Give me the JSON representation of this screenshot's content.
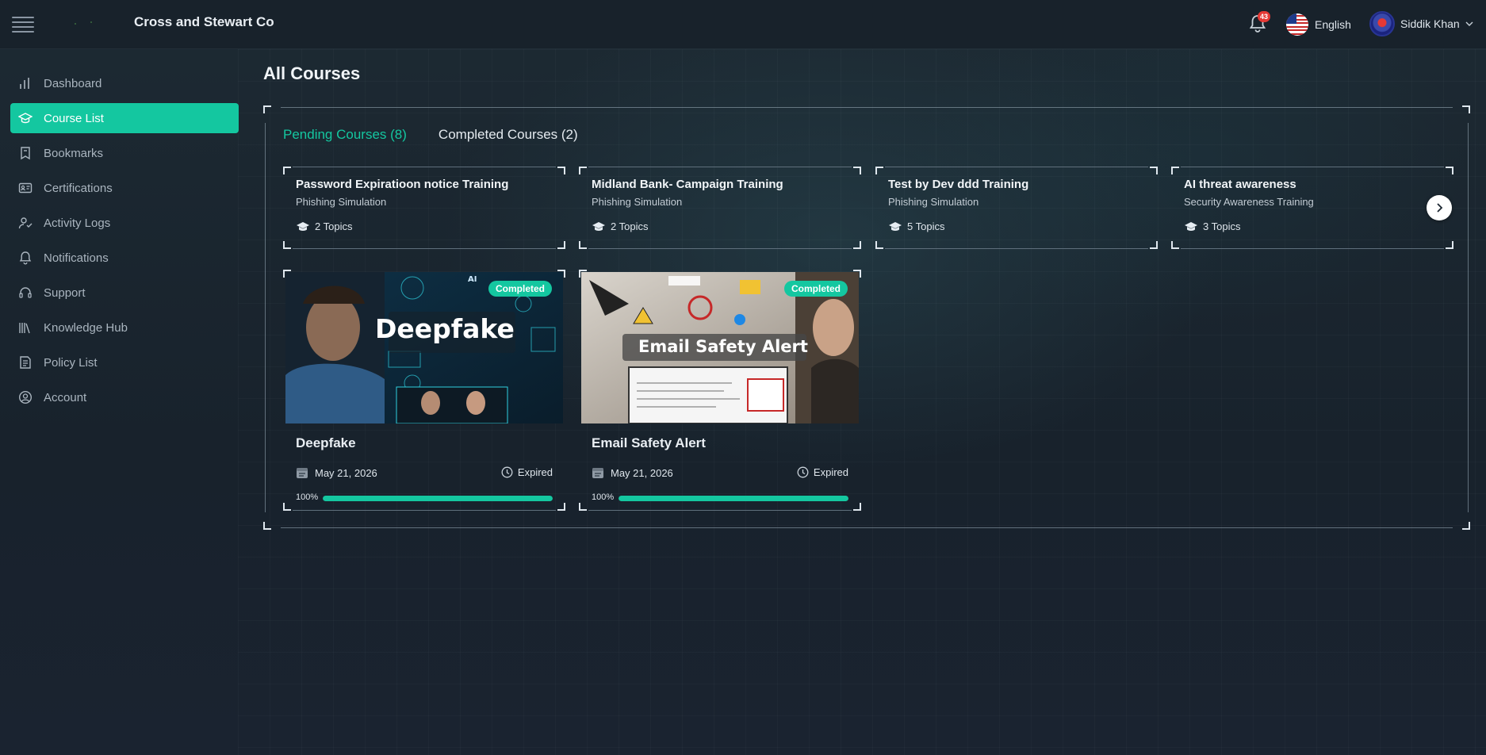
{
  "header": {
    "company": "Cross and Stewart Co",
    "notification_count": "43",
    "language": "English",
    "user_name": "Siddik Khan"
  },
  "sidebar": {
    "items": [
      {
        "label": "Dashboard",
        "icon": "bar-chart-icon"
      },
      {
        "label": "Course List",
        "icon": "graduation-cap-icon",
        "active": true
      },
      {
        "label": "Bookmarks",
        "icon": "bookmark-icon"
      },
      {
        "label": "Certifications",
        "icon": "id-card-icon"
      },
      {
        "label": "Activity Logs",
        "icon": "user-activity-icon"
      },
      {
        "label": "Notifications",
        "icon": "bell-icon"
      },
      {
        "label": "Support",
        "icon": "headset-icon"
      },
      {
        "label": "Knowledge Hub",
        "icon": "books-icon"
      },
      {
        "label": "Policy List",
        "icon": "document-list-icon"
      },
      {
        "label": "Account",
        "icon": "user-circle-icon"
      }
    ]
  },
  "main": {
    "title": "All Courses",
    "tabs": [
      {
        "label": "Pending Courses (8)",
        "active": true
      },
      {
        "label": "Completed Courses (2)",
        "active": false
      }
    ],
    "pending": [
      {
        "title": "Password Expiratioon notice Training",
        "type": "Phishing Simulation",
        "topics": "2 Topics"
      },
      {
        "title": "Midland Bank- Campaign Training",
        "type": "Phishing Simulation",
        "topics": "2 Topics"
      },
      {
        "title": "Test by Dev ddd Training",
        "type": "Phishing Simulation",
        "topics": "5 Topics"
      },
      {
        "title": "AI threat awareness",
        "type": "Security Awareness Training",
        "topics": "3 Topics"
      }
    ],
    "completed": [
      {
        "badge": "Completed",
        "thumb_text": "Deepfake",
        "thumb_tag": "AI",
        "title": "Deepfake",
        "date": "May 21, 2026",
        "status": "Expired",
        "progress_label": "100%",
        "progress": 1.0
      },
      {
        "badge": "Completed",
        "thumb_text": "Email Safety Alert",
        "title": "Email Safety Alert",
        "date": "May 21, 2026",
        "status": "Expired",
        "progress_label": "100%",
        "progress": 1.0
      }
    ]
  },
  "colors": {
    "accent": "#14c7a0",
    "background": "#1b2530",
    "badge_red": "#e53935"
  }
}
